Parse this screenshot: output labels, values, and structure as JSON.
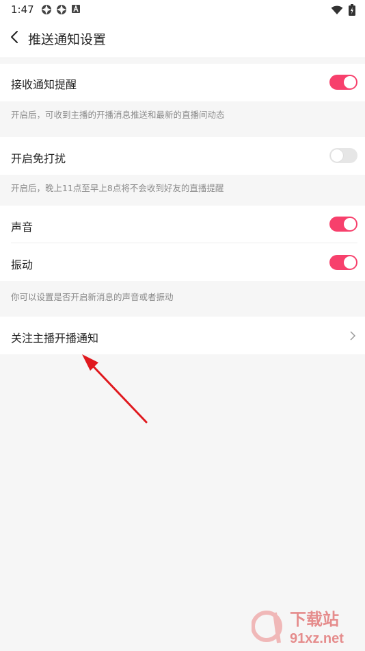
{
  "status": {
    "time": "1:47"
  },
  "header": {
    "title": "推送通知设置"
  },
  "settings": {
    "receive": {
      "label": "接收通知提醒",
      "on": true,
      "hint": "开启后，可收到主播的开播消息推送和最新的直播间动态"
    },
    "dnd": {
      "label": "开启免打扰",
      "on": false,
      "hint": "开启后，晚上11点至早上8点将不会收到好友的直播提醒"
    },
    "sound": {
      "label": "声音",
      "on": true
    },
    "vibrate": {
      "label": "振动",
      "on": true
    },
    "sound_hint": "你可以设置是否开启新消息的声音或者振动",
    "follow": {
      "label": "关注主播开播通知"
    }
  },
  "colors": {
    "accent": "#f7406c",
    "arrow": "#e0191e"
  },
  "watermark": {
    "brand": "下载站",
    "domain": "91xz.net"
  }
}
